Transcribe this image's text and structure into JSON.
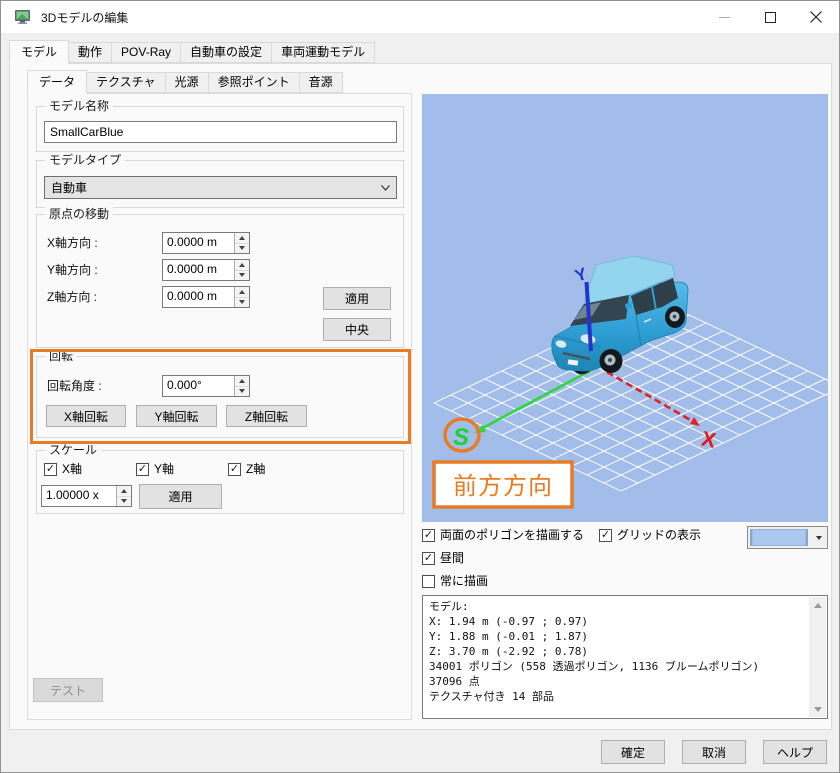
{
  "window": {
    "title": "3Dモデルの編集"
  },
  "main_tabs": [
    {
      "label": "モデル",
      "active": true
    },
    {
      "label": "動作",
      "active": false
    },
    {
      "label": "POV-Ray",
      "active": false
    },
    {
      "label": "自動車の設定",
      "active": false
    },
    {
      "label": "車両運動モデル",
      "active": false
    }
  ],
  "sub_tabs": [
    {
      "label": "データ",
      "active": true
    },
    {
      "label": "テクスチャ",
      "active": false
    },
    {
      "label": "光源",
      "active": false
    },
    {
      "label": "参照ポイント",
      "active": false
    },
    {
      "label": "音源",
      "active": false
    }
  ],
  "model_name": {
    "legend": "モデル名称",
    "value": "SmallCarBlue"
  },
  "model_type": {
    "legend": "モデルタイプ",
    "value": "自動車"
  },
  "origin": {
    "legend": "原点の移動",
    "x_label": "X軸方向 :",
    "x_value": "0.0000 m",
    "y_label": "Y軸方向 :",
    "y_value": "0.0000 m",
    "z_label": "Z軸方向 :",
    "z_value": "0.0000 m",
    "apply": "適用",
    "center": "中央"
  },
  "rotation": {
    "legend": "回転",
    "angle_label": "回転角度 :",
    "angle_value": "0.000°",
    "x_button": "X軸回転",
    "y_button": "Y軸回転",
    "z_button": "Z軸回転",
    "highlight_color": "#e87c24"
  },
  "scale": {
    "legend": "スケール",
    "x_check": "X軸",
    "x_checked": true,
    "y_check": "Y軸",
    "y_checked": true,
    "z_check": "Z軸",
    "z_checked": true,
    "value": "1.00000 x",
    "apply": "適用"
  },
  "test_button": "テスト",
  "viewport": {
    "bg_color": "#a2bde9",
    "axis_forward": "S",
    "axis_forward_color": "#1bd42c",
    "axis_x": "X",
    "axis_x_color": "#e01818",
    "axis_up": "Y",
    "axis_up_color": "#2433cc",
    "forward_label": "前方方向",
    "annotation_color": "#e87c24"
  },
  "view_options": {
    "both_sides": "両面のポリゴンを描画する",
    "both_sides_checked": true,
    "grid": "グリッドの表示",
    "grid_checked": true,
    "grid_color_swatch": "#abc8f1",
    "daytime": "昼間",
    "daytime_checked": true,
    "always_draw": "常に描画",
    "always_draw_checked": false
  },
  "info": {
    "lines": [
      "モデル:",
      "X: 1.94 m (-0.97 ; 0.97)",
      "Y: 1.88 m (-0.01 ; 1.87)",
      "Z: 3.70 m (-2.92 ; 0.78)",
      "34001 ポリゴン (558 透過ポリゴン, 1136 ブルームポリゴン)",
      "37096 点",
      "テクスチャ付き 14 部品"
    ]
  },
  "footer": {
    "ok": "確定",
    "cancel": "取消",
    "help": "ヘルプ"
  }
}
